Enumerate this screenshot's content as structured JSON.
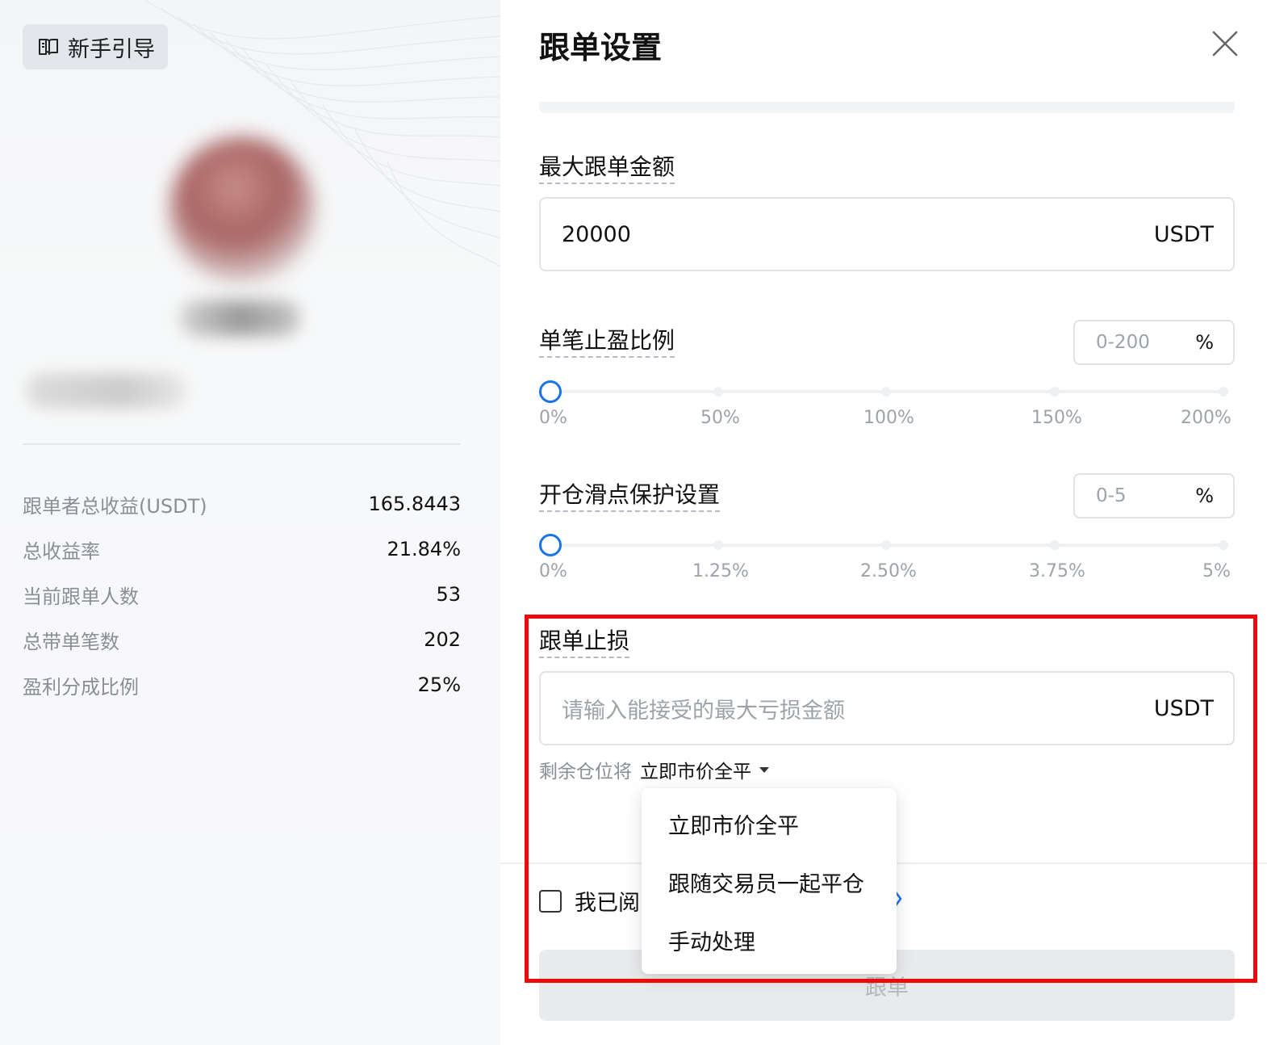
{
  "left": {
    "guide_button": "新手引导",
    "stats": [
      {
        "label": "跟单者总收益(USDT)",
        "value": "165.8443"
      },
      {
        "label": "总收益率",
        "value": "21.84%"
      },
      {
        "label": "当前跟单人数",
        "value": "53"
      },
      {
        "label": "总带单笔数",
        "value": "202"
      },
      {
        "label": "盈利分成比例",
        "value": "25%"
      }
    ]
  },
  "right": {
    "title": "跟单设置",
    "max_amount": {
      "label": "最大跟单金额",
      "value": "20000",
      "unit": "USDT"
    },
    "take_profit": {
      "label": "单笔止盈比例",
      "placeholder": "0-200",
      "unit": "%",
      "slider_value": 0,
      "ticks": [
        "0%",
        "50%",
        "100%",
        "150%",
        "200%"
      ]
    },
    "slippage": {
      "label": "开仓滑点保护设置",
      "placeholder": "0-5",
      "unit": "%",
      "slider_value": 0,
      "ticks": [
        "0%",
        "1.25%",
        "2.50%",
        "3.75%",
        "5%"
      ]
    },
    "stop_loss": {
      "label": "跟单止损",
      "placeholder": "请输入能接受的最大亏损金额",
      "unit": "USDT",
      "remaining_label": "剩余仓位将",
      "selected": "立即市价全平",
      "options": [
        "立即市价全平",
        "跟随交易员一起平仓",
        "手动处理"
      ]
    },
    "agree_text": "我已阅",
    "follow_button": "跟单"
  },
  "colors": {
    "accent": "#1a73e8",
    "highlight": "#ee0a0a"
  }
}
